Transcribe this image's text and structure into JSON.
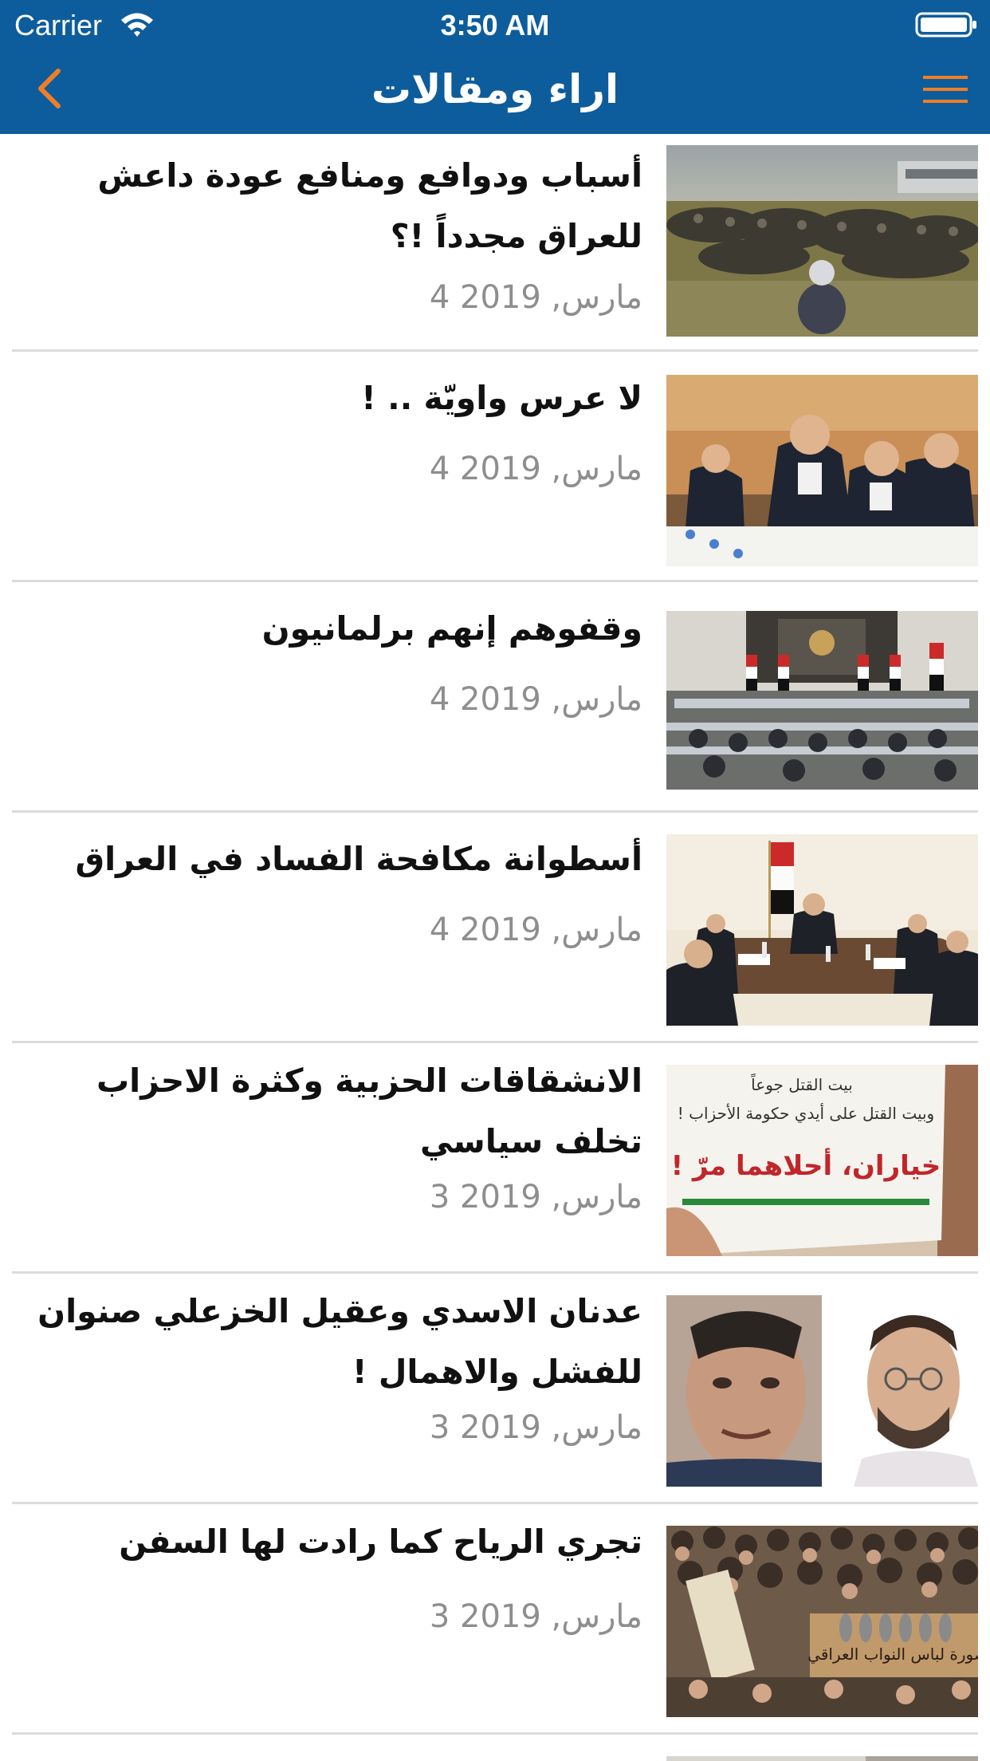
{
  "status_bar": {
    "carrier": "Carrier",
    "time": "3:50 AM",
    "wifi_icon": "wifi-icon",
    "battery_icon": "battery-icon"
  },
  "nav": {
    "title": "اراء ومقالات",
    "back_icon": "chevron-left-icon",
    "menu_icon": "hamburger-menu-icon",
    "bar_color": "#0d5d9c",
    "icon_color": "#f07e26"
  },
  "articles": [
    {
      "title": "أسباب ودوافع ومنافع عودة داعش للعراق مجدداً !؟",
      "date": "4 مارس, 2019",
      "image": "detainees-sitting-in-field-photo"
    },
    {
      "title": "لا عرس واويّة .. !",
      "date": "4 مارس, 2019",
      "image": "officials-at-meeting-table-photo"
    },
    {
      "title": "وقفوهم إنهم برلمانيون",
      "date": "4 مارس, 2019",
      "image": "parliament-session-photo"
    },
    {
      "title": "أسطوانة مكافحة الفساد في العراق",
      "date": "4 مارس, 2019",
      "image": "cabinet-meeting-with-flag-photo"
    },
    {
      "title": "الانشقاقات الحزبية وكثرة الاحزاب تخلف سياسي",
      "date": "3 مارس, 2019",
      "image": "protest-sign-photo",
      "sign_lines": [
        "بيت القتل جوعاً",
        "وبيت القتل على أيدي حكومة الأحزاب !",
        "خياران، أحلاهما مرّ !"
      ]
    },
    {
      "title": "عدنان الاسدي وعقيل الخزعلي صنوان للفشل والاهمال !",
      "date": "3 مارس, 2019",
      "image": "two-portraits-photo"
    },
    {
      "title": "تجري الرياح كما رادت لها السفن",
      "date": "3 مارس, 2019",
      "image": "protest-crowd-with-shoes-photo",
      "sign_text": "صورة لباس النواب العراقي"
    }
  ]
}
